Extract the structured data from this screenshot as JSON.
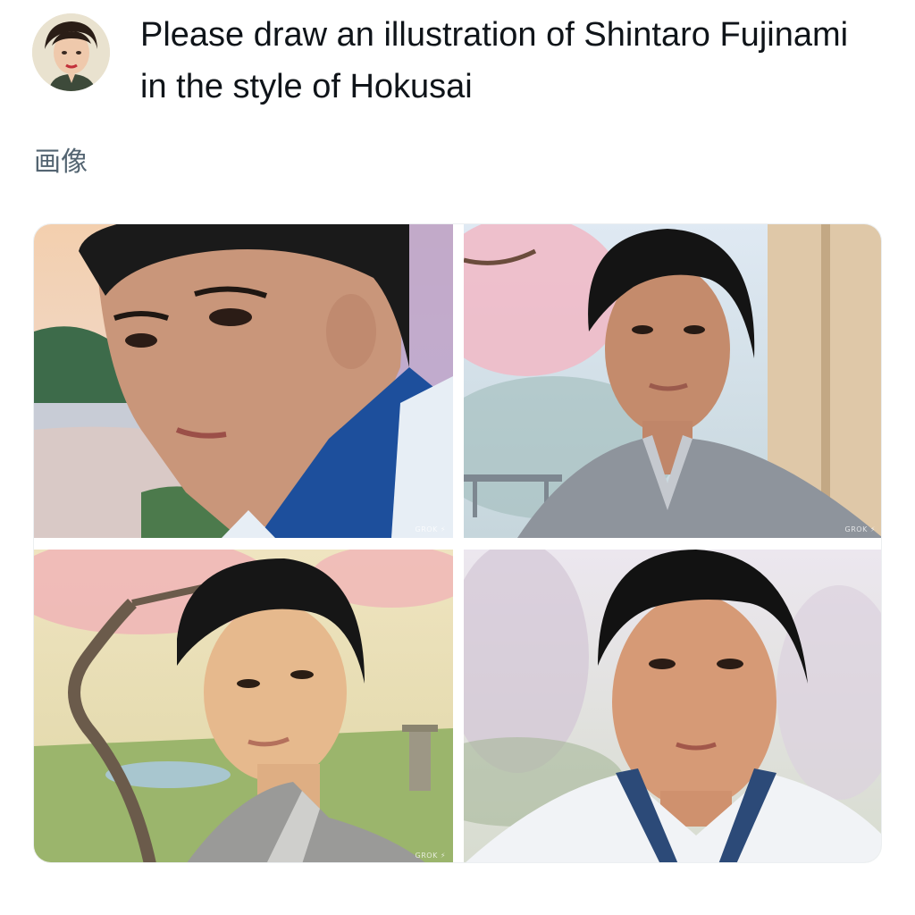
{
  "post": {
    "prompt_text": "Please draw an illustration of Shintaro Fujinami in the style of Hokusai",
    "avatar_icon": "user-avatar-portrait"
  },
  "section": {
    "label": "画像"
  },
  "images": [
    {
      "id": "image-1",
      "watermark": "GROK ⚡",
      "palette": {
        "sky": "#f2c9a8",
        "robe": "#1d4f9c",
        "hair": "#1a1a1a"
      }
    },
    {
      "id": "image-2",
      "watermark": "GROK ⚡",
      "palette": {
        "sky": "#dbe7f2",
        "robe": "#8e949c",
        "hair": "#141414"
      }
    },
    {
      "id": "image-3",
      "watermark": "GROK ⚡",
      "palette": {
        "sky": "#e9dfb4",
        "robe": "#9a9a98",
        "hair": "#161616"
      }
    },
    {
      "id": "image-4",
      "watermark": "",
      "palette": {
        "sky": "#e7e2ea",
        "robe": "#f1f3f6",
        "hair": "#121212"
      }
    }
  ]
}
